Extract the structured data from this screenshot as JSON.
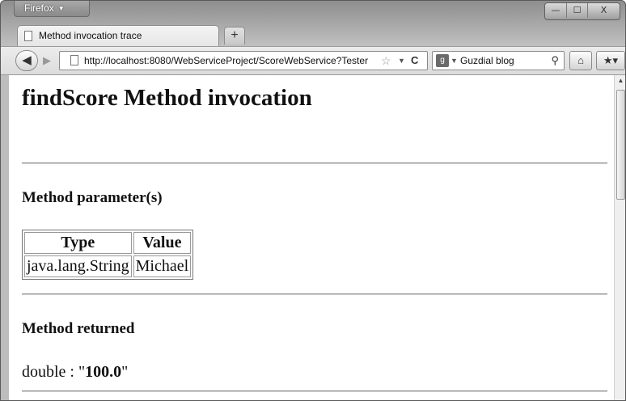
{
  "browser": {
    "app_button_label": "Firefox",
    "window_controls": {
      "minimize": "—",
      "maximize": "☐",
      "close": "X"
    },
    "tab": {
      "title": "Method invocation trace"
    },
    "new_tab_label": "+",
    "address": "http://localhost:8080/WebServiceProject/ScoreWebService?Tester",
    "search": {
      "engine_name": "Guzdial blog"
    },
    "icons": {
      "back": "back-arrow-icon",
      "forward": "forward-arrow-icon",
      "page": "page-icon",
      "star": "bookmark-star-icon",
      "reload": "reload-icon",
      "search": "magnifier-icon",
      "home": "home-icon",
      "bookmarks": "bookmarks-icon"
    }
  },
  "page": {
    "title": "findScore Method invocation",
    "params_heading": "Method parameter(s)",
    "params_table": {
      "headers": [
        "Type",
        "Value"
      ],
      "rows": [
        [
          "java.lang.String",
          "Michael"
        ]
      ]
    },
    "returned_heading": "Method returned",
    "result_type": "double : \"",
    "result_value": "100.0",
    "result_suffix": "\""
  }
}
